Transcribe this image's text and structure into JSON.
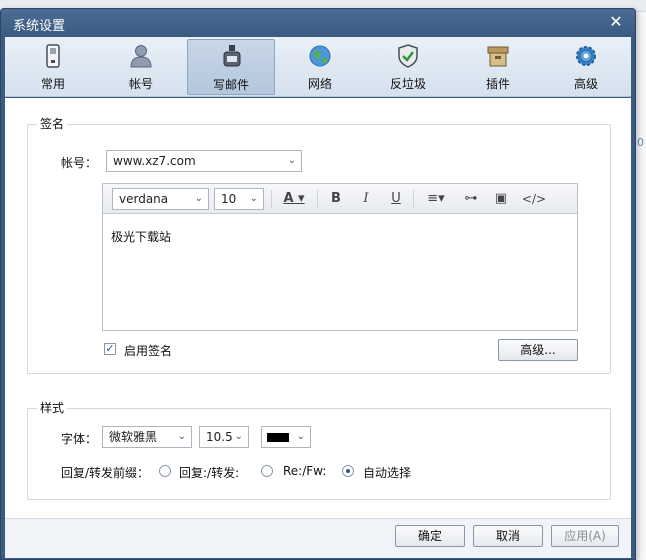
{
  "dialog": {
    "title": "系统设置"
  },
  "toolbar": {
    "items": [
      {
        "label": "常用",
        "icon": "phone-icon"
      },
      {
        "label": "帐号",
        "icon": "user-icon"
      },
      {
        "label": "写邮件",
        "icon": "ink-bottle-icon",
        "active": true
      },
      {
        "label": "网络",
        "icon": "globe-icon"
      },
      {
        "label": "反垃圾",
        "icon": "shield-icon"
      },
      {
        "label": "插件",
        "icon": "box-icon"
      },
      {
        "label": "高级",
        "icon": "gear-icon"
      }
    ]
  },
  "signature": {
    "group_title": "签名",
    "account_label": "帐号：",
    "account_value": "www.xz7.com",
    "font_value": "verdana",
    "size_value": "10",
    "body_text": "极光下载站",
    "enable_label": "启用签名",
    "enable_checked": true,
    "advanced_button": "高级..."
  },
  "style": {
    "group_title": "样式",
    "font_label": "字体：",
    "font_value": "微软雅黑",
    "size_value": "10.5",
    "color_value": "#000000",
    "prefix_label": "回复/转发前缀：",
    "options": [
      {
        "label": "回复:/转发:",
        "selected": false
      },
      {
        "label": "Re:/Fw:",
        "selected": false
      },
      {
        "label": "自动选择",
        "selected": true
      }
    ]
  },
  "buttons": {
    "ok": "确定",
    "cancel": "取消",
    "apply": "应用(A)"
  },
  "background": {
    "digit": "0"
  },
  "colors": {
    "titlebar": "#3d5a80",
    "accent": "#2a5a93"
  }
}
